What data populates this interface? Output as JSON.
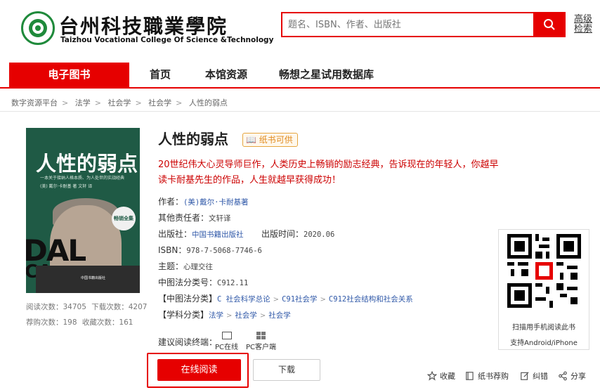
{
  "header": {
    "logo_cn": "台州科技職業學院",
    "logo_en": "Taizhou Vocational College Of Science &Technology",
    "search_placeholder": "题名、ISBN、作者、出版社",
    "advanced_search": "高级检索"
  },
  "nav": {
    "items": [
      "电子图书",
      "首页",
      "本馆资源",
      "畅想之星试用数据库"
    ],
    "active": "电子图书"
  },
  "breadcrumb": [
    "数字资源平台",
    "法学",
    "社会学",
    "社会学",
    "人性的弱点"
  ],
  "cover": {
    "title": "人性的弱点",
    "subtitle1": "一本关于接纳人格本质、为人处世的实战经典",
    "subtitle2": "(美) 戴尔·卡耐基 著    文轩 译",
    "badge": "畅销全集",
    "big1": "DAL",
    "big2": "CA",
    "publisher": "中国书籍出版社"
  },
  "stats": {
    "row1": [
      "阅读次数：34705",
      "下载次数：4207"
    ],
    "row2": [
      "荐购次数：198",
      "收藏次数：161"
    ]
  },
  "book": {
    "title": "人性的弱点",
    "paper_badge": "纸书可供",
    "desc_line1": "20世纪伟大心灵导师巨作，人类历史上畅销的励志经典，告诉现在的年轻人，你越早",
    "desc_line2": "读卡耐基先生的作品，人生就越早获得成功！",
    "author_label": "作者：",
    "author": "(美)戴尔·卡耐基著",
    "other_label": "其他责任者：",
    "other": "文轩译",
    "publisher_label": "出版社：",
    "publisher": "中国书籍出版社",
    "pubtime_label": "出版时间：",
    "pubtime": "2020.06",
    "isbn_label": "ISBN：",
    "isbn": "978-7-5068-7746-6",
    "subject_label": "主题：",
    "subject": "心理交往",
    "clc_label": "中图法分类号：",
    "clc": "C912.11",
    "clc_class_label": "【中图法分类】",
    "clc_class": [
      "C 社会科学总论",
      "C91社会学",
      "C912社会结构和社会关系"
    ],
    "discipline_label": "【学科分类】",
    "discipline": [
      "法学",
      "社会学",
      "社会学"
    ],
    "reading_terminal_label": "建议阅读终端：",
    "terminal_pc_online": "PC在线",
    "terminal_pc_client": "PC客户端"
  },
  "buttons": {
    "read_online": "在线阅读",
    "download": "下载"
  },
  "qr": {
    "caption1": "扫描用手机阅读此书",
    "caption2": "支持Android/iPhone"
  },
  "actions": {
    "favorite": "收藏",
    "recommend": "纸书荐购",
    "correct": "纠错",
    "share": "分享"
  },
  "colors": {
    "accent": "#e60000",
    "link": "#2f58a8",
    "desc": "#cc0000"
  }
}
